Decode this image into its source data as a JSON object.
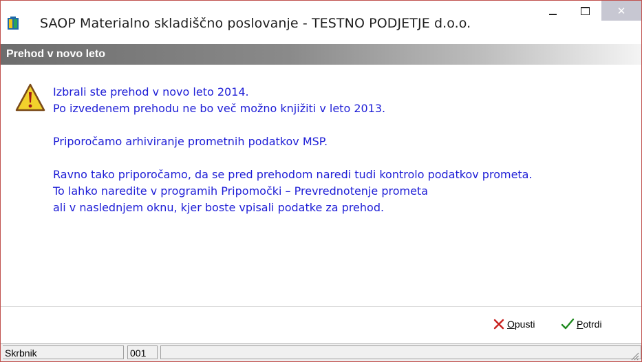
{
  "window": {
    "title": "SAOP Materialno skladiščno poslovanje - TESTNO PODJETJE d.o.o.",
    "close_symbol": "✕",
    "app_icon": "saop-app-icon"
  },
  "dialog": {
    "header": "Prehod v novo leto",
    "icon": "warning-icon",
    "lines": {
      "l1": "Izbrali ste prehod v novo leto 2014.",
      "l2": "Po izvedenem prehodu ne bo več možno knjižiti v leto 2013.",
      "l3": "Priporočamo arhiviranje prometnih podatkov MSP.",
      "l4": "Ravno tako priporočamo, da se pred prehodom naredi tudi kontrolo podatkov prometa.",
      "l5": "To lahko naredite v programih Pripomočki – Prevrednotenje prometa",
      "l6": "ali v naslednjem oknu, kjer boste vpisali podatke za prehod."
    },
    "text_color": "#1d1dd6"
  },
  "buttons": {
    "cancel": {
      "hotkey": "O",
      "rest": "pusti",
      "icon": "red-x-icon"
    },
    "confirm": {
      "hotkey": "P",
      "rest": "otrdi",
      "icon": "green-check-icon"
    }
  },
  "statusbar": {
    "user": "Skrbnik",
    "code": "001",
    "extra": ""
  }
}
